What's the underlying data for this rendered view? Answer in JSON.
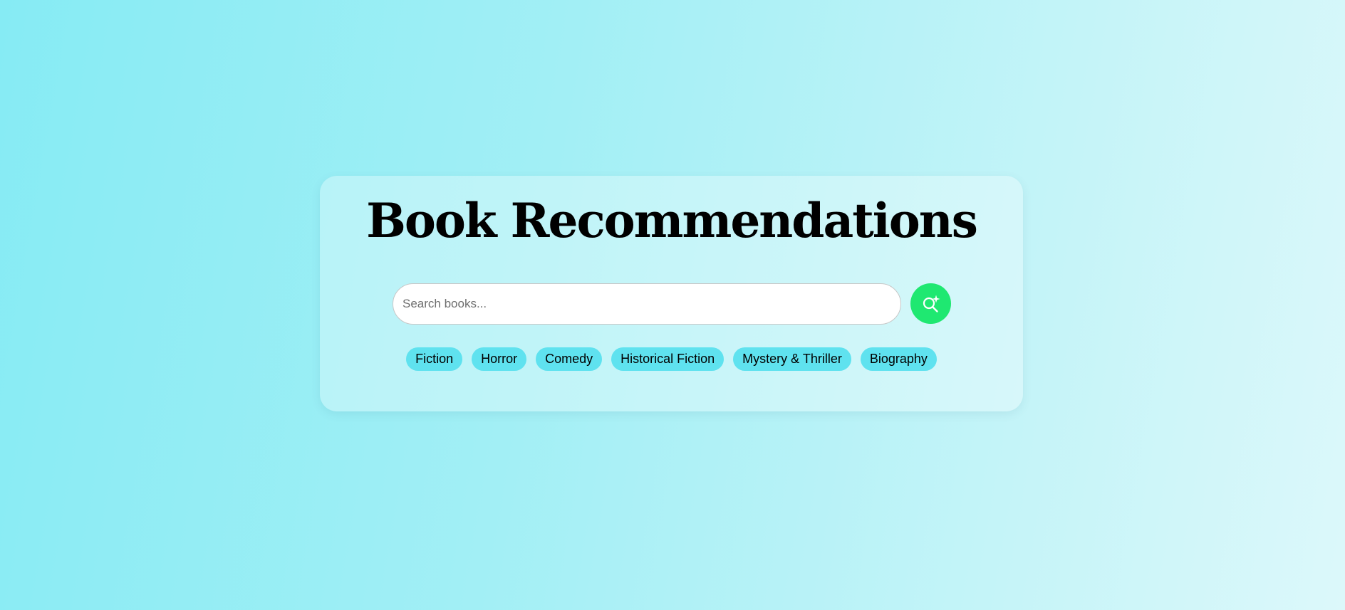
{
  "header": {
    "title": "Book Recommendations"
  },
  "search": {
    "placeholder": "Search books...",
    "value": "",
    "button_icon": "sparkle-search-icon"
  },
  "genres": [
    {
      "label": "Fiction"
    },
    {
      "label": "Horror"
    },
    {
      "label": "Comedy"
    },
    {
      "label": "Historical Fiction"
    },
    {
      "label": "Mystery & Thriller"
    },
    {
      "label": "Biography"
    }
  ],
  "colors": {
    "search_button": "#1fe871",
    "genre_tag": "#5fe2ef",
    "title_text": "#000000"
  }
}
